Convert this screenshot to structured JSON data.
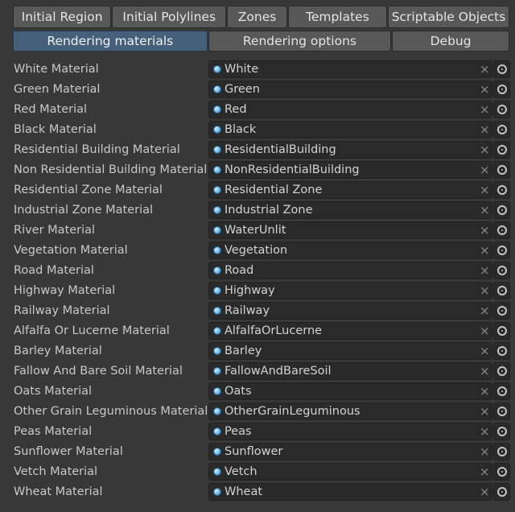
{
  "tabs_row1": [
    {
      "label": "Initial Region",
      "name": "tab-initial-region"
    },
    {
      "label": "Initial Polylines",
      "name": "tab-initial-polylines"
    },
    {
      "label": "Zones",
      "name": "tab-zones"
    },
    {
      "label": "Templates",
      "name": "tab-templates"
    },
    {
      "label": "Scriptable Objects",
      "name": "tab-scriptable-objects"
    }
  ],
  "tabs_row2": [
    {
      "label": "Rendering materials",
      "name": "tab-rendering-materials",
      "active": true
    },
    {
      "label": "Rendering options",
      "name": "tab-rendering-options",
      "active": false
    },
    {
      "label": "Debug",
      "name": "tab-debug",
      "active": false
    }
  ],
  "materials": [
    {
      "label": "White Material",
      "value": "White"
    },
    {
      "label": "Green Material",
      "value": "Green"
    },
    {
      "label": "Red Material",
      "value": "Red"
    },
    {
      "label": "Black Material",
      "value": "Black"
    },
    {
      "label": "Residential Building Material",
      "value": "ResidentialBuilding"
    },
    {
      "label": "Non Residential Building Material",
      "value": "NonResidentialBuilding"
    },
    {
      "label": "Residential Zone Material",
      "value": "Residential Zone"
    },
    {
      "label": "Industrial Zone Material",
      "value": "Industrial Zone"
    },
    {
      "label": "River Material",
      "value": "WaterUnlit"
    },
    {
      "label": "Vegetation Material",
      "value": "Vegetation"
    },
    {
      "label": "Road Material",
      "value": "Road"
    },
    {
      "label": "Highway Material",
      "value": "Highway"
    },
    {
      "label": "Railway Material",
      "value": "Railway"
    },
    {
      "label": "Alfalfa Or Lucerne Material",
      "value": "AlfalfaOrLucerne"
    },
    {
      "label": "Barley Material",
      "value": "Barley"
    },
    {
      "label": "Fallow And Bare Soil Material",
      "value": "FallowAndBareSoil"
    },
    {
      "label": "Oats Material",
      "value": "Oats"
    },
    {
      "label": "Other Grain Leguminous Material",
      "value": "OtherGrainLeguminous"
    },
    {
      "label": "Peas Material",
      "value": "Peas"
    },
    {
      "label": "Sunflower Material",
      "value": "Sunflower"
    },
    {
      "label": "Vetch Material",
      "value": "Vetch"
    },
    {
      "label": "Wheat Material",
      "value": "Wheat"
    }
  ],
  "icons": {
    "clear": "×",
    "object_icon": "material-sphere-icon",
    "picker_icon": "object-picker-icon"
  },
  "colors": {
    "background": "#383838",
    "active_tab": "#46607c",
    "tab": "#585858",
    "field": "#2a2a2a"
  }
}
